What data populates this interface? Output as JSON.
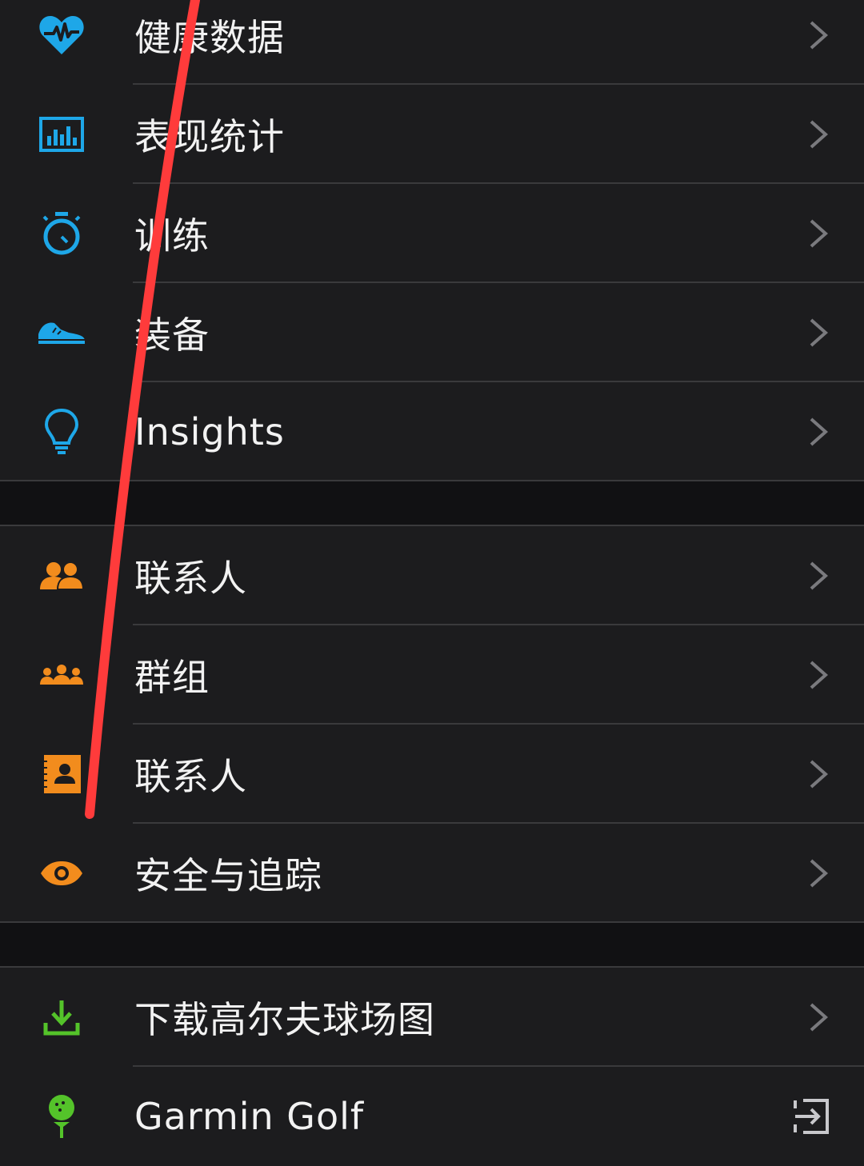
{
  "colors": {
    "background": "#1c1c1e",
    "separator": "#3a3a3c",
    "section_gap": "#111113",
    "blue": "#1ea7e8",
    "orange": "#f28c1d",
    "green": "#54c32a",
    "chevron": "#7a7a7e",
    "annotation_red": "#ff3b3b"
  },
  "sections": [
    {
      "items": [
        {
          "label": "健康数据",
          "icon": "heart-pulse-icon"
        },
        {
          "label": "表现统计",
          "icon": "bar-chart-icon"
        },
        {
          "label": "训练",
          "icon": "stopwatch-icon"
        },
        {
          "label": "装备",
          "icon": "shoe-icon"
        },
        {
          "label": "Insights",
          "icon": "lightbulb-icon"
        }
      ]
    },
    {
      "items": [
        {
          "label": "联系人",
          "icon": "people-icon"
        },
        {
          "label": "群组",
          "icon": "group-icon"
        },
        {
          "label": "联系人",
          "icon": "address-book-icon"
        },
        {
          "label": "安全与追踪",
          "icon": "eye-icon"
        }
      ]
    },
    {
      "items": [
        {
          "label": "下载高尔夫球场图",
          "icon": "download-icon"
        },
        {
          "label": "Garmin Golf",
          "icon": "golf-ball-tee-icon",
          "trailing": "external-link-icon"
        }
      ]
    }
  ]
}
